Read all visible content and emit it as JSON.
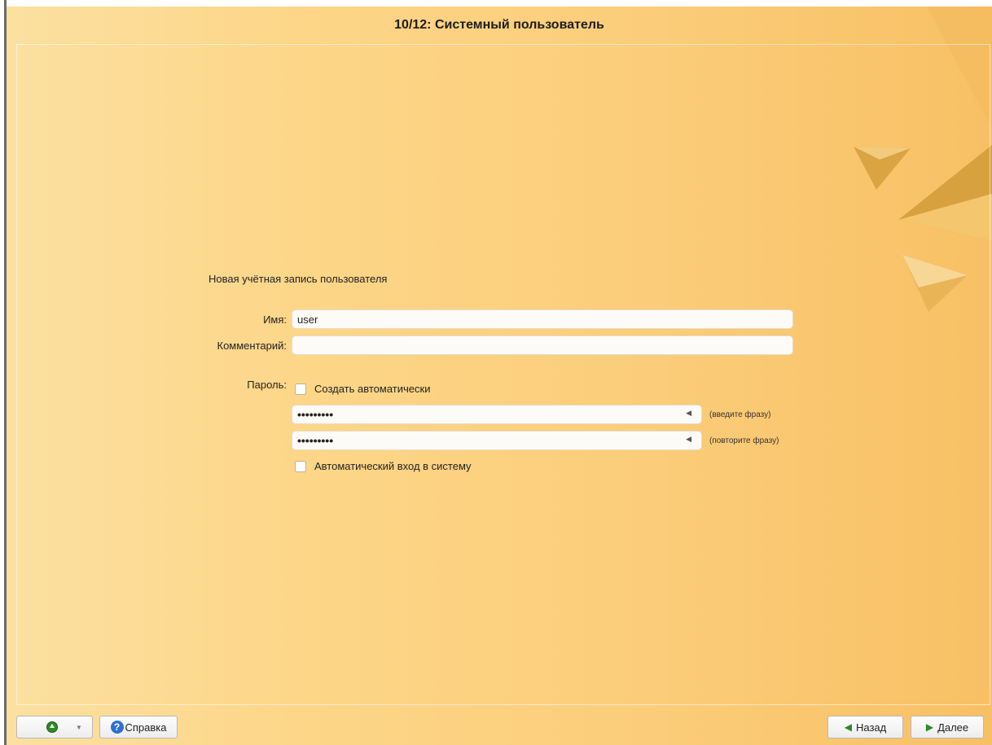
{
  "header": {
    "title": "10/12: Системный пользователь"
  },
  "form": {
    "section_title": "Новая учётная запись пользователя",
    "name_label": "Имя:",
    "name_value": "user",
    "comment_label": "Комментарий:",
    "comment_value": "",
    "password_label": "Пароль:",
    "auto_generate_label": "Создать автоматически",
    "auto_generate_checked": false,
    "password_value": "•••••••••",
    "password_hint": "(введите фразу)",
    "password_repeat_value": "•••••••••",
    "password_repeat_hint": "(повторите фразу)",
    "autologin_label": "Автоматический вход в систему",
    "autologin_checked": false
  },
  "footer": {
    "help_label": "Справка",
    "back_label": "Назад",
    "next_label": "Далее"
  },
  "icons": {
    "up": "up-arrow-icon",
    "dropdown": "dropdown-arrow-icon",
    "help": "help-icon",
    "back": "chevron-left-icon",
    "next": "chevron-right-icon",
    "password_field": "triangle-left-icon"
  },
  "colors": {
    "accent_green": "#2b8a2b",
    "help_blue": "#2e6fd1",
    "background_gold": "#fbcd7a"
  }
}
